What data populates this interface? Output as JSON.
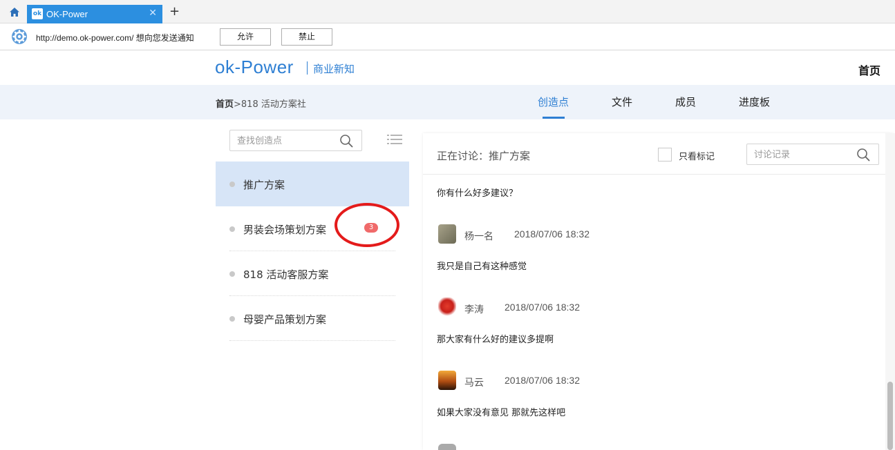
{
  "browser": {
    "tab_title": "OK-Power",
    "tab_favicon": "ok",
    "notification": {
      "text": "http://demo.ok-power.com/ 想向您发送通知",
      "allow_label": "允许",
      "deny_label": "禁止"
    }
  },
  "header": {
    "logo": "ok-Power",
    "logo_sub": "商业新知",
    "home_link": "首页"
  },
  "subnav": {
    "breadcrumb_home": "首页",
    "breadcrumb_rest": ">818 活动方案社",
    "tabs": [
      {
        "label": "创造点",
        "active": true
      },
      {
        "label": "文件",
        "active": false
      },
      {
        "label": "成员",
        "active": false
      },
      {
        "label": "进度板",
        "active": false
      }
    ]
  },
  "left": {
    "search_placeholder": "查找创造点",
    "items": [
      {
        "label": "推广方案",
        "selected": true
      },
      {
        "label": "男装会场策划方案",
        "badge": "3"
      },
      {
        "label": "818 活动客服方案"
      },
      {
        "label": "母婴产品策划方案"
      }
    ]
  },
  "discussion": {
    "title": "正在讨论：推广方案",
    "mark_only_label": "只看标记",
    "record_placeholder": "讨论记录",
    "first_message": "你有什么好多建议？",
    "messages": [
      {
        "name": "杨一名",
        "time": "2018/07/06 18:32",
        "text": "我只是自己有这种感觉"
      },
      {
        "name": "李涛",
        "time": "2018/07/06 18:32",
        "text": "那大家有什么好的建议多提啊"
      },
      {
        "name": "马云",
        "time": "2018/07/06 18:32",
        "text": "如果大家没有意见 那就先这样吧"
      }
    ]
  },
  "colors": {
    "accent": "#2e7fd3",
    "tab_blue": "#2c8fe0",
    "badge_red": "#f06a6a",
    "annotation_red": "#e41b1b",
    "selected_bg": "#d7e5f7"
  },
  "icons": [
    "home-icon",
    "close-icon",
    "plus-icon",
    "gear-icon",
    "search-icon",
    "list-menu-icon"
  ]
}
